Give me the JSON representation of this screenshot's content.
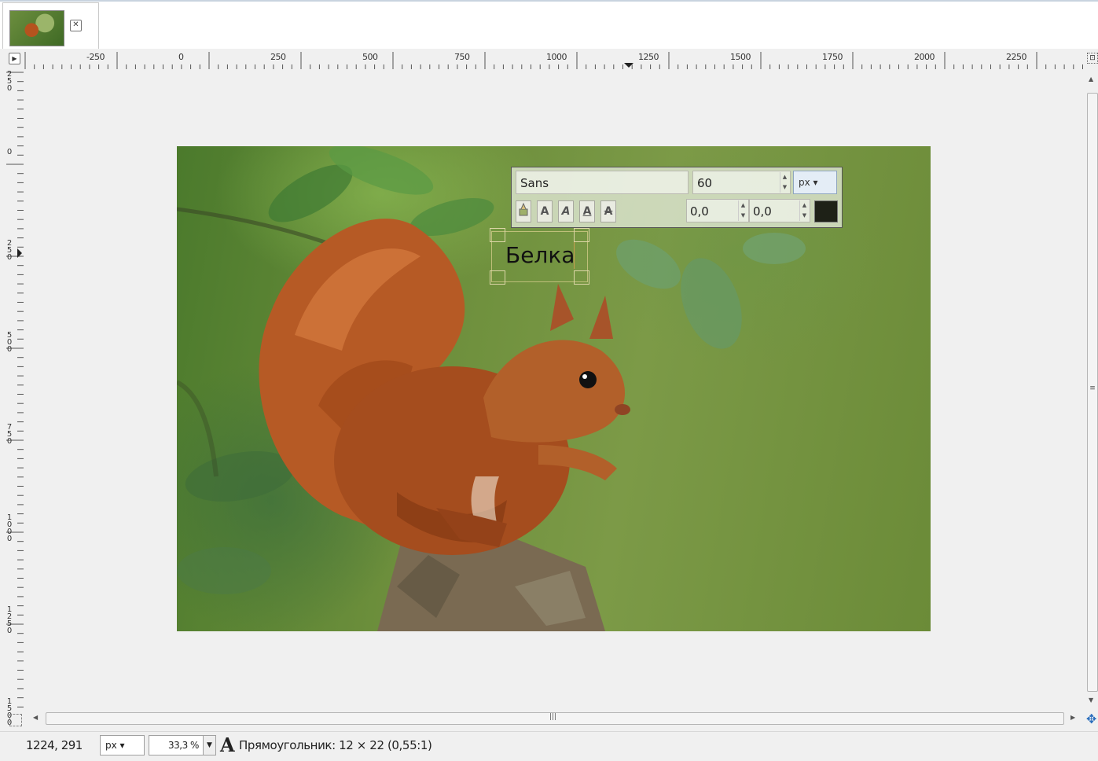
{
  "tabs": [
    {
      "thumbnail": "squirrel-thumbnail",
      "close_icon": "close-icon",
      "close_glyph": "✕"
    }
  ],
  "rulers": {
    "horizontal_labels": [
      "-250",
      "0",
      "250",
      "500",
      "750",
      "1000",
      "1250",
      "1500",
      "1750",
      "2000",
      "2250"
    ],
    "vertical_labels": [
      "250",
      "0",
      "250",
      "500",
      "750",
      "1000",
      "1250",
      "1500"
    ]
  },
  "image": {
    "description_icon": "squirrel-photo",
    "text_layer": "Белка"
  },
  "text_toolbar": {
    "font": "Sans",
    "size": "60",
    "unit": "px",
    "baseline_offset": "0,0",
    "kerning": "0,0",
    "color": "#1e2117",
    "style_buttons": [
      "A",
      "A",
      "A",
      "A"
    ]
  },
  "statusbar": {
    "pointer_coords": "1224, 291",
    "unit": "px",
    "zoom": "33,3 %",
    "message": "Прямоугольник: 12 × 22  (0,55:1)"
  }
}
